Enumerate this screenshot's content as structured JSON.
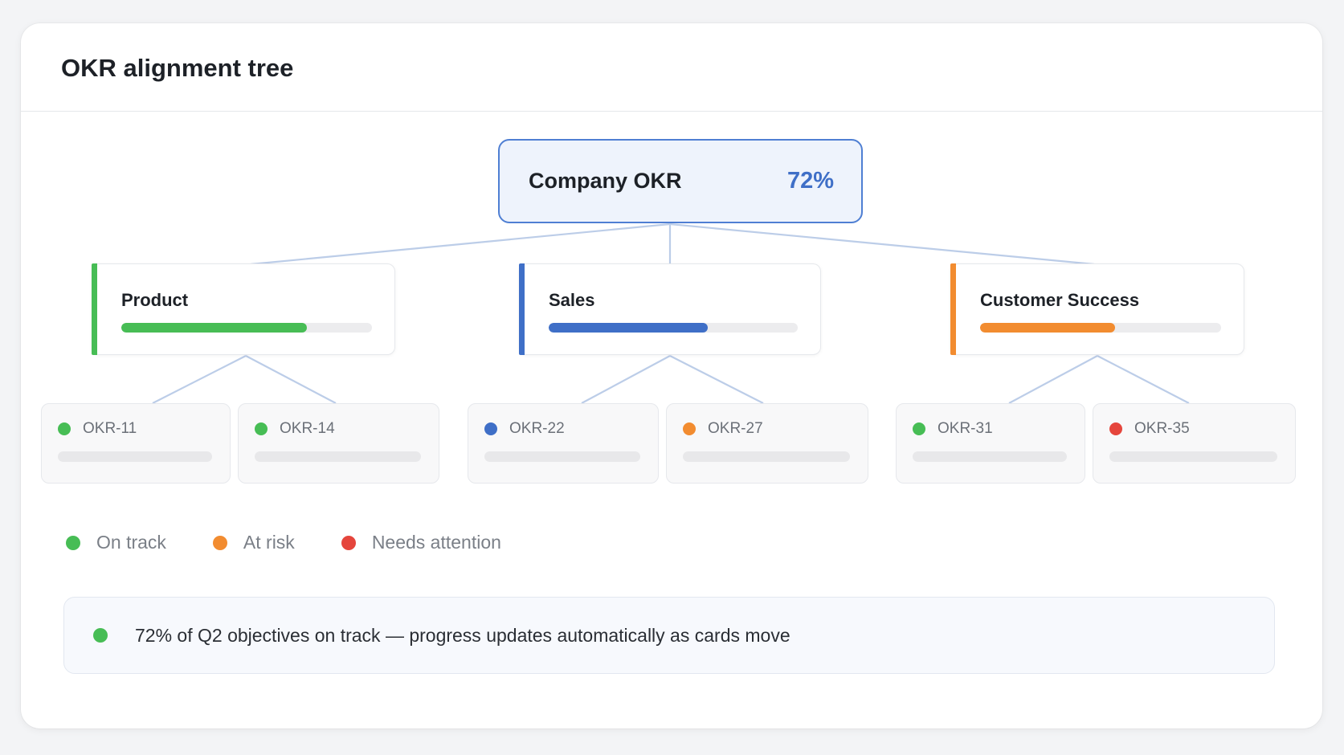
{
  "page": {
    "title": "OKR alignment tree"
  },
  "colors": {
    "on_track": "#47bd55",
    "at_risk": "#f28c30",
    "needs_attention": "#e5453c",
    "blue": "#3f6fc7",
    "connector": "#bccde8"
  },
  "root": {
    "label": "Company OKR",
    "value": "72%"
  },
  "teams": [
    {
      "name": "Product",
      "color": "#47bd55",
      "progress": 0.74
    },
    {
      "name": "Sales",
      "color": "#3f6fc7",
      "progress": 0.64
    },
    {
      "name": "Customer Success",
      "color": "#f28c30",
      "progress": 0.56
    }
  ],
  "okrs": [
    {
      "id": "OKR-11",
      "status_color": "#47bd55"
    },
    {
      "id": "OKR-14",
      "status_color": "#47bd55"
    },
    {
      "id": "OKR-22",
      "status_color": "#3f6fc7"
    },
    {
      "id": "OKR-27",
      "status_color": "#f28c30"
    },
    {
      "id": "OKR-31",
      "status_color": "#47bd55"
    },
    {
      "id": "OKR-35",
      "status_color": "#e5453c"
    }
  ],
  "legend": [
    {
      "label": "On track",
      "color": "#47bd55"
    },
    {
      "label": "At risk",
      "color": "#f28c30"
    },
    {
      "label": "Needs attention",
      "color": "#e5453c"
    }
  ],
  "summary": {
    "text": "72% of Q2 objectives on track — progress updates automatically as cards move",
    "color": "#47bd55"
  }
}
